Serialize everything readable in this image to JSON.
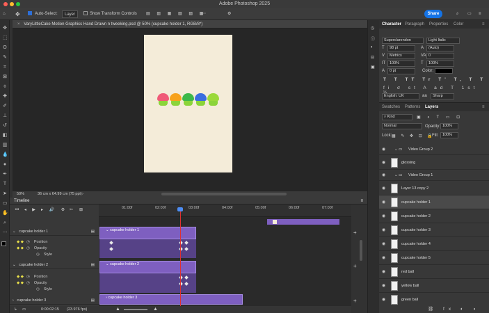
{
  "app": {
    "title": "Adobe Photoshop 2025",
    "share_label": "Share"
  },
  "options_bar": {
    "auto_select_label": "Auto-Select:",
    "auto_select_target": "Layer",
    "transform_controls_label": "Show Transform Controls"
  },
  "document": {
    "tab_title": "VaryLittleCake Motion Graphics Hand Drawn n tweeking.psd @ 50% (cupcake holder 1, RGB/8*)",
    "zoom": "50%",
    "dimensions": "36 cm x 64.99 cm (75 ppi)"
  },
  "cupcakes": [
    {
      "top_color": "#f05a78"
    },
    {
      "top_color": "#f7a21c"
    },
    {
      "top_color": "#3cb84a"
    },
    {
      "top_color": "#3a6de0"
    },
    {
      "top_color": "#9bd93a"
    }
  ],
  "timeline": {
    "panel_title": "Timeline",
    "ruler_labels": [
      "01:00f",
      "02:00f",
      "03:00f",
      "04:00f",
      "05:00f",
      "06:00f",
      "07:00f"
    ],
    "current_time": "0:00:02:15",
    "fps": "(23.976 fps)",
    "layers": [
      {
        "name": "cupcake holder 1",
        "bar_label": "cupcake holder 1"
      },
      {
        "name": "cupcake holder 2",
        "bar_label": "cupcake holder 2"
      },
      {
        "name": "cupcake holder 3",
        "bar_label": "cupcake holder 3"
      }
    ],
    "props": [
      "Position",
      "Opacity",
      "Style"
    ]
  },
  "character_panel": {
    "tabs": [
      "Character",
      "Paragraph",
      "Properties",
      "Color"
    ],
    "font_family": "Superclarendon",
    "font_style": "Light Italic",
    "font_size": "98 pt",
    "leading": "(Auto)",
    "kerning": "Metrics",
    "tracking": "0",
    "vertical_scale": "100%",
    "horizontal_scale": "100%",
    "baseline_shift": "0 pt",
    "color_label": "Color:",
    "language": "English: UK",
    "antialias": "Sharp"
  },
  "layers_panel": {
    "tabs": [
      "Swatches",
      "Patterns",
      "Layers"
    ],
    "filter_kind": "Kind",
    "blend_mode": "Normal",
    "opacity_label": "Opacity:",
    "opacity_value": "100%",
    "lock_label": "Lock:",
    "fill_label": "Fill:",
    "fill_value": "100%",
    "rows": [
      {
        "name": "Video Group 2",
        "type": "group"
      },
      {
        "name": "glossing",
        "type": "layer"
      },
      {
        "name": "Video Group 1",
        "type": "group"
      },
      {
        "name": "Layer 13 copy 2",
        "type": "layer"
      },
      {
        "name": "cupcake holder 1",
        "type": "layer",
        "selected": true
      },
      {
        "name": "cupcake holder 2",
        "type": "layer"
      },
      {
        "name": "cupcake holder 3",
        "type": "layer"
      },
      {
        "name": "cupcake holder 4",
        "type": "layer"
      },
      {
        "name": "cupcake holder 5",
        "type": "layer"
      },
      {
        "name": "red ball",
        "type": "layer"
      },
      {
        "name": "yellow ball",
        "type": "layer"
      },
      {
        "name": "green ball",
        "type": "layer"
      }
    ]
  }
}
